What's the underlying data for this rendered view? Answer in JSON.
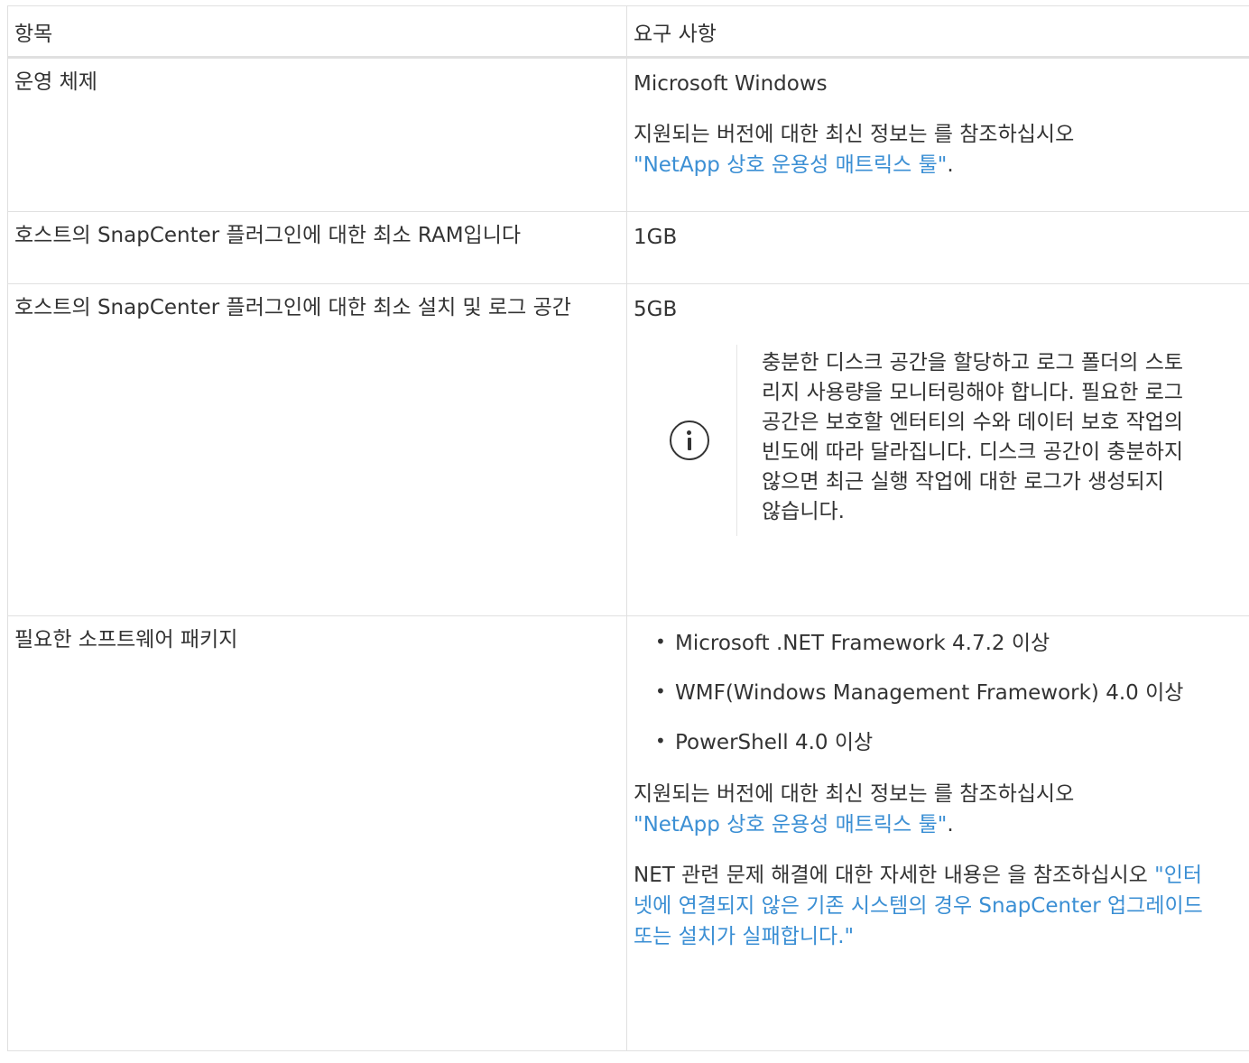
{
  "header": {
    "col1": "항목",
    "col2": "요구 사항"
  },
  "rows": {
    "os": {
      "label": "운영 체제",
      "value": "Microsoft Windows",
      "note_prefix": "지원되는 버전에 대한 최신 정보는 를 참조하십시오",
      "link": "\"NetApp 상호 운용성 매트릭스 툴\"",
      "note_suffix": "."
    },
    "ram": {
      "label": "호스트의 SnapCenter 플러그인에 대한 최소 RAM입니다",
      "value": "1GB"
    },
    "disk": {
      "label": "호스트의 SnapCenter 플러그인에 대한 최소 설치 및 로그 공간",
      "value": "5GB",
      "note_icon": "info-icon",
      "note": "충분한 디스크 공간을 할당하고 로그 폴더의 스토리지 사용량을 모니터링해야 합니다. 필요한 로그 공간은 보호할 엔터티의 수와 데이터 보호 작업의 빈도에 따라 달라집니다. 디스크 공간이 충분하지 않으면 최근 실행 작업에 대한 로그가 생성되지 않습니다."
    },
    "software": {
      "label": "필요한 소프트웨어 패키지",
      "items": [
        "Microsoft .NET Framework 4.7.2 이상",
        "WMF(Windows Management Framework) 4.0 이상",
        "PowerShell 4.0 이상"
      ],
      "note_prefix": "지원되는 버전에 대한 최신 정보는 를 참조하십시오",
      "link": "\"NetApp 상호 운용성 매트릭스 툴\"",
      "note_suffix": ".",
      "net_prefix": "NET 관련 문제 해결에 대한 자세한 내용은 을 참조하십시오",
      "net_link": "\"인터넷에 연결되지 않은 기존 시스템의 경우 SnapCenter 업그레이드 또는 설치가 실패합니다.\""
    }
  }
}
